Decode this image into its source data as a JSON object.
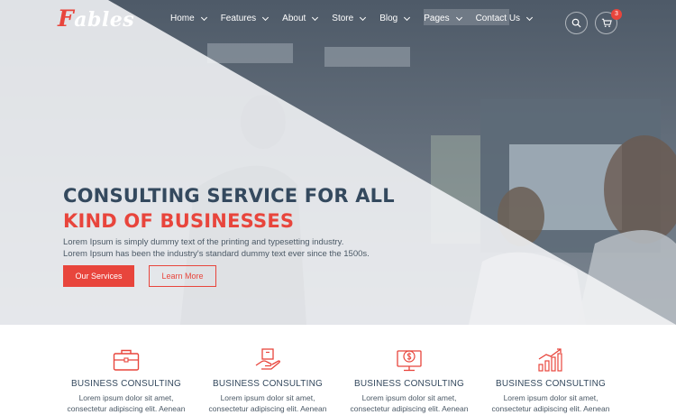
{
  "brand": {
    "logo_first": "F",
    "logo_rest": "ables"
  },
  "nav": {
    "items": [
      {
        "label": "Home"
      },
      {
        "label": "Features"
      },
      {
        "label": "About"
      },
      {
        "label": "Store"
      },
      {
        "label": "Blog"
      },
      {
        "label": "Pages"
      },
      {
        "label": "Contact Us"
      }
    ],
    "cart_count": "3",
    "search_icon": "search-icon",
    "cart_icon": "cart-icon"
  },
  "hero": {
    "title_line1": "CONSULTING SERVICE FOR ALL",
    "title_line2": "KIND OF BUSINESSES",
    "description": "Lorem Ipsum is simply dummy text of the printing and typesetting industry. Lorem Ipsum has been the industry's standard dummy text ever since the 1500s.",
    "primary_button": "Our Services",
    "secondary_button": "Learn More"
  },
  "services": [
    {
      "icon": "briefcase-icon",
      "title": "BUSINESS CONSULTING",
      "description": "Lorem ipsum dolor sit amet, consectetur adipiscing elit. Aenean"
    },
    {
      "icon": "hand-box-icon",
      "title": "BUSINESS CONSULTING",
      "description": "Lorem ipsum dolor sit amet, consectetur adipiscing elit. Aenean"
    },
    {
      "icon": "monitor-dollar-icon",
      "title": "BUSINESS CONSULTING",
      "description": "Lorem ipsum dolor sit amet, consectetur adipiscing elit. Aenean"
    },
    {
      "icon": "growth-chart-icon",
      "title": "BUSINESS CONSULTING",
      "description": "Lorem ipsum dolor sit amet, consectetur adipiscing elit. Aenean"
    }
  ],
  "colors": {
    "accent": "#e8453c",
    "heading": "#34495e",
    "text": "#4b5966"
  }
}
